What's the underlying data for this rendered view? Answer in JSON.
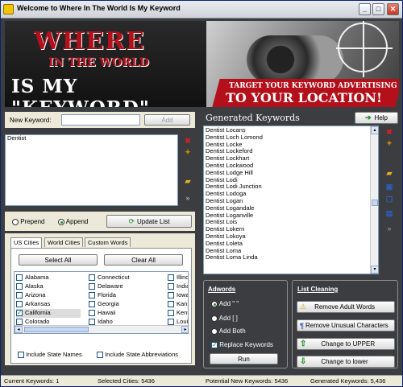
{
  "window": {
    "title": "Welcome to Where In The World Is My Keyword"
  },
  "banner": {
    "line1": "WHERE",
    "line2": "IN THE WORLD",
    "line3": "IS MY \"KEYWORD\"",
    "tagline1": "TARGET YOUR KEYWORD ADVERTISING",
    "tagline2": "TO YOUR LOCATION!"
  },
  "keywords": {
    "new_keyword_label": "New Keyword:",
    "new_keyword_value": "",
    "add_label": "Add",
    "list": [
      "Dentist"
    ]
  },
  "mode": {
    "prepend_label": "Prepend",
    "append_label": "Append",
    "selected": "Append",
    "update_label": "Update List"
  },
  "tabs": [
    "US Cities",
    "World Cities",
    "Custom Words"
  ],
  "cities": {
    "select_all": "Select All",
    "clear_all": "Clear All",
    "col1": [
      "Alabama",
      "Alaska",
      "Arizona",
      "Arkansas",
      "California",
      "Colorado"
    ],
    "col2": [
      "Connecticut",
      "Delaware",
      "Florida",
      "Georgia",
      "Hawaii",
      "Idaho"
    ],
    "col3": [
      "Illinois",
      "Indian",
      "Iowa",
      "Kansa",
      "Kentu",
      "Louisi"
    ],
    "checked": [
      "California"
    ],
    "include_state_names": "Include State Names",
    "include_state_abbrev": "Include State Abbreviations"
  },
  "generated": {
    "title": "Generated Keywords",
    "help_label": "Help",
    "items": [
      "Dentist Locans",
      "Dentist Loch Lomond",
      "Dentist Locke",
      "Dentist Lockeford",
      "Dentist Lockhart",
      "Dentist Lockwood",
      "Dentist Lodge Hill",
      "Dentist Lodi",
      "Dentist Lodi Junction",
      "Dentist Lodoga",
      "Dentist Logan",
      "Dentist Logandale",
      "Dentist Loganville",
      "Dentist Lois",
      "Dentist Lokern",
      "Dentist Lokoya",
      "Dentist Loleta",
      "Dentist Loma",
      "Dentist Loma Linda"
    ]
  },
  "adwords": {
    "title": "Adwords",
    "opt1": "Add \" \"",
    "opt2": "Add [ ]",
    "opt3": "Add Both",
    "replace_label": "Replace Keywords",
    "run_label": "Run"
  },
  "cleaning": {
    "title": "List Cleaning",
    "remove_adult": "Remove Adult Words",
    "remove_unusual": "Remove Unusual Characters",
    "to_upper": "Change to UPPER",
    "to_lower": "Change to lower"
  },
  "status": {
    "current_keywords": "Current Keywords: 1",
    "selected_cities": "Selected Cities: 5436",
    "potential": "Potential New Keywords: 5436",
    "generated_count": "Generated Keywords: 5,436"
  },
  "colors": {
    "accent": "#b3101b",
    "background": "#3b3d41"
  }
}
